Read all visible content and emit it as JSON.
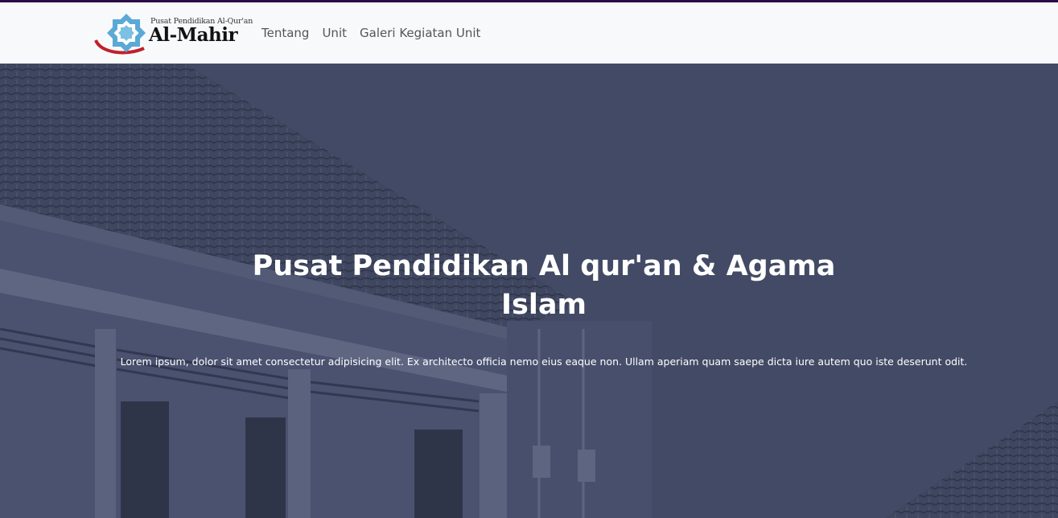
{
  "brand": {
    "subtitle": "Pusat Pendidikan Al-Qur'an",
    "name": "Al-Mahir"
  },
  "nav": {
    "items": [
      "Tentang",
      "Unit",
      "Galeri Kegiatan Unit"
    ]
  },
  "hero": {
    "title": "Pusat Pendidikan Al qur'an & Agama Islam",
    "text": "Lorem ipsum, dolor sit amet consectetur adipisicing elit. Ex architecto officia nemo eius eaque non. Ullam aperiam quam saepe dicta iure autem quo iste deserunt odit."
  },
  "colors": {
    "overlay": "#434a65",
    "navbar": "#f8f9fb",
    "topline": "#2c0a45",
    "logo_blue": "#5aa9d6",
    "logo_red": "#c0202a"
  }
}
